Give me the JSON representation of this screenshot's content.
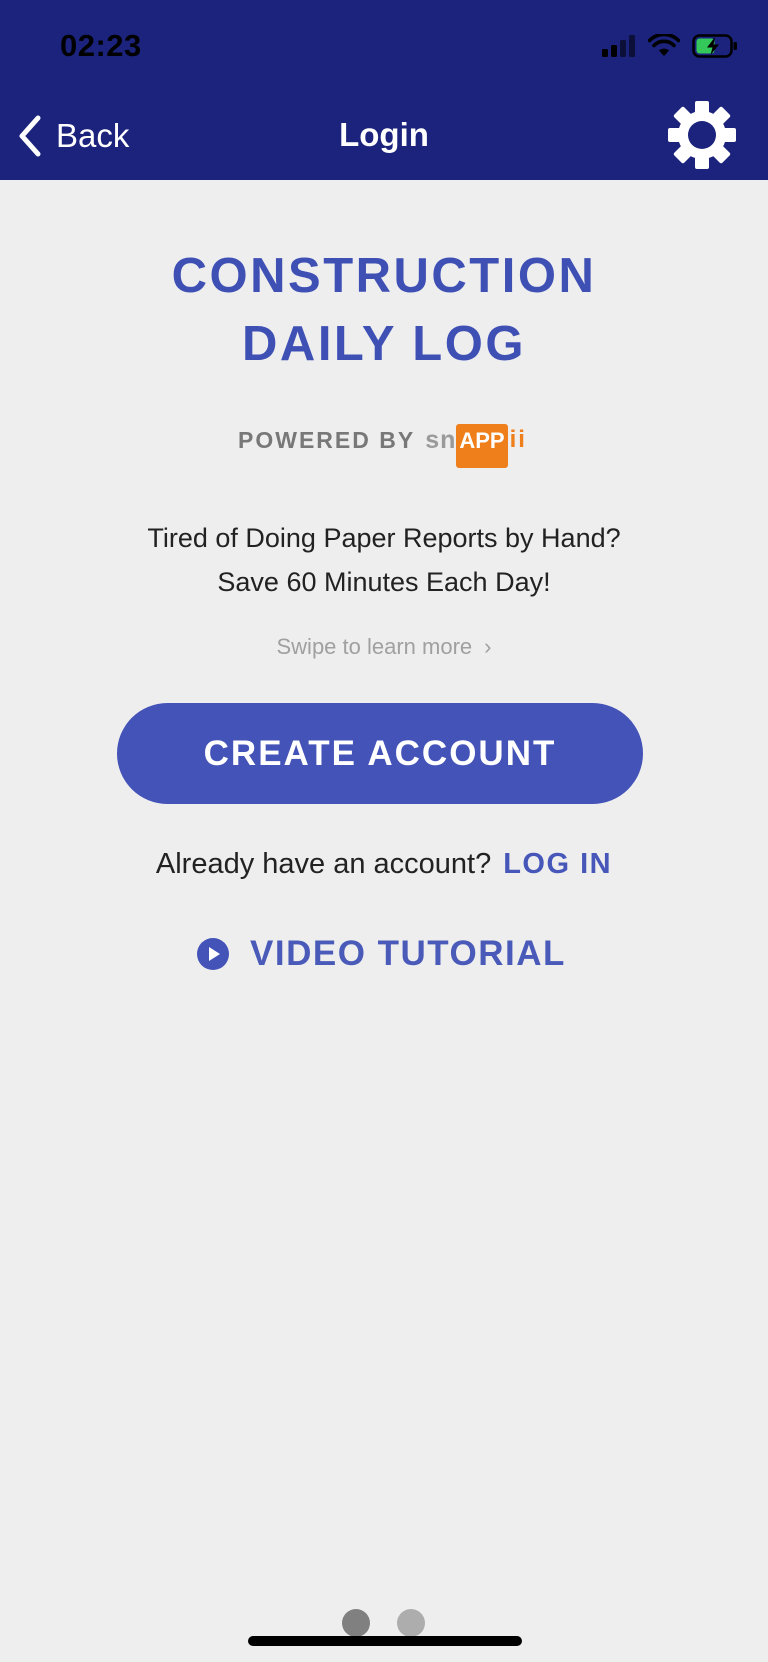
{
  "status_bar": {
    "time": "02:23",
    "icons": [
      "signal-icon",
      "wifi-icon",
      "battery-charging-icon"
    ]
  },
  "nav": {
    "back_label": "Back",
    "title": "Login",
    "settings_icon": "gear-icon"
  },
  "main": {
    "app_title_line1": "CONSTRUCTION",
    "app_title_line2": "DAILY LOG",
    "powered_by": "POWERED BY",
    "brand_sn": "sn",
    "brand_app": "APP",
    "brand_ii": "ii",
    "tagline_line1": "Tired of Doing Paper Reports by Hand?",
    "tagline_line2": "Save 60 Minutes Each Day!",
    "swipe_hint": "Swipe to learn more",
    "create_account_label": "CREATE ACCOUNT",
    "login_prompt": "Already have an account?",
    "login_link": "LOG IN",
    "video_tutorial_label": "VIDEO TUTORIAL"
  },
  "pager": {
    "pages": 2,
    "active_index": 0
  },
  "colors": {
    "nav_bg": "#1b237c",
    "accent": "#3f50b5",
    "button_bg": "#4353b8",
    "background": "#eeeeef",
    "brand_orange": "#ef7f1a"
  }
}
